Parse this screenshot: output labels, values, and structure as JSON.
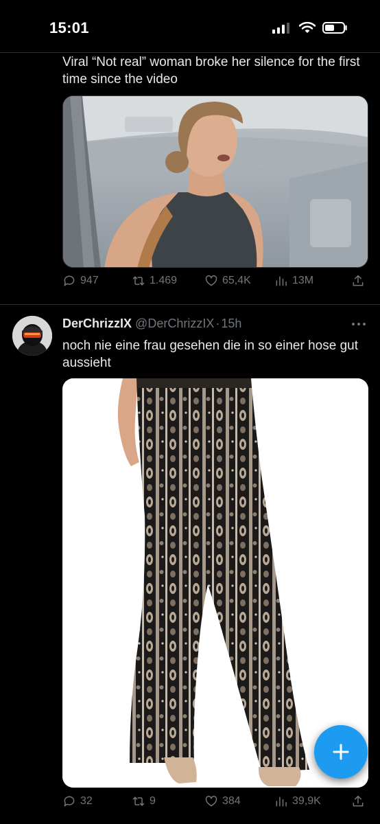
{
  "status_bar": {
    "time": "15:01",
    "icons": [
      "cellular-signal-icon",
      "wifi-icon",
      "battery-icon"
    ]
  },
  "tweet_previous": {
    "text": "Viral “Not real” woman broke her silence for the first time since the video",
    "media": "photo-woman-on-airplane",
    "actions": {
      "replies": "947",
      "retweets": "1.469",
      "likes": "65,4K",
      "views": "13M"
    }
  },
  "tweet_main": {
    "display_name": "DerChrizzIX",
    "handle": "@DerChrizzIX",
    "separator": "·",
    "time": "15h",
    "text": "noch nie eine frau gesehen die in so einer hose gut aussieht",
    "media": "photo-patterned-flared-pants",
    "actions": {
      "replies": "32",
      "retweets": "9",
      "likes": "384",
      "views": "39,9K"
    }
  },
  "compose_button": {
    "icon": "plus-icon"
  },
  "colors": {
    "background": "#000000",
    "text_primary": "#e7e9ea",
    "text_secondary": "#71767b",
    "divider": "#2f3336",
    "accent": "#1d9bf0"
  }
}
